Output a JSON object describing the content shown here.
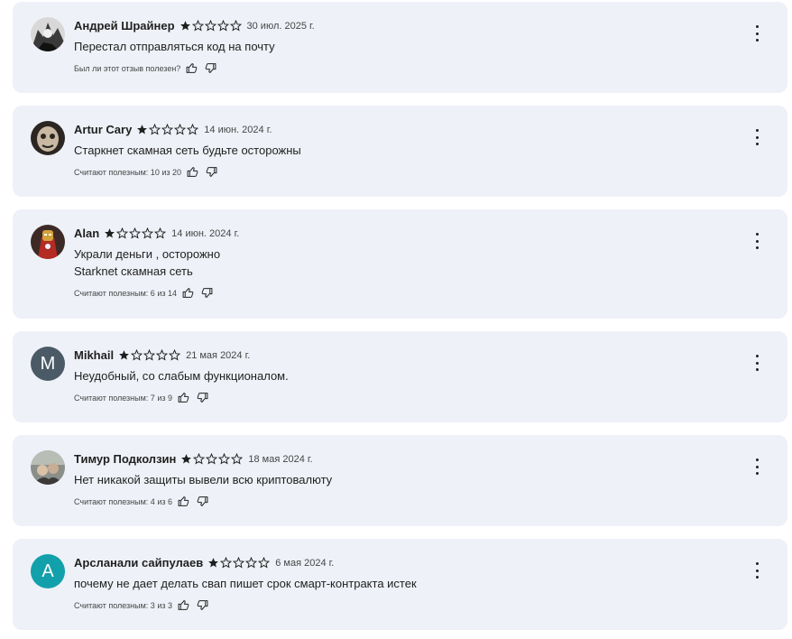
{
  "colors": {
    "card_bg": "#eef1f7",
    "star_filled": "#1f1f1f",
    "avatar_mikhail": "#4a5a66",
    "avatar_arslanali": "#12a0ab"
  },
  "reviews": [
    {
      "author": "Андрей Шрайнер",
      "rating": 1,
      "date": "30 июл. 2025 г.",
      "text": [
        "Перестал отправляться код на почту"
      ],
      "helpful": "Был ли этот отзыв полезен?",
      "avatar_icon": "photo-avatar"
    },
    {
      "author": "Artur Cary",
      "rating": 1,
      "date": "14 июн. 2024 г.",
      "text": [
        "Старкнет скамная сеть будьте осторожны"
      ],
      "helpful": "Считают полезным: 10 из 20",
      "avatar_icon": "photo-avatar"
    },
    {
      "author": "Alan",
      "rating": 1,
      "date": "14 июн. 2024 г.",
      "text": [
        "Украли деньги , осторожно",
        "Starknet скамная сеть"
      ],
      "helpful": "Считают полезным: 6 из 14",
      "avatar_icon": "photo-avatar"
    },
    {
      "author": "Mikhail",
      "rating": 1,
      "date": "21 мая 2024 г.",
      "text": [
        "Неудобный, со слабым функционалом."
      ],
      "helpful": "Считают полезным: 7 из 9",
      "avatar_letter": "M"
    },
    {
      "author": "Тимур Подколзин",
      "rating": 1,
      "date": "18 мая 2024 г.",
      "text": [
        "Нет никакой защиты вывели всю криптовалюту"
      ],
      "helpful": "Считают полезным: 4 из 6",
      "avatar_icon": "photo-avatar"
    },
    {
      "author": "Арсланали сайпулаев",
      "rating": 1,
      "date": "6 мая 2024 г.",
      "text": [
        "почему не дает делать свап пишет срок смарт-контракта истек"
      ],
      "helpful": "Считают полезным: 3 из 3",
      "avatar_letter": "A"
    }
  ]
}
